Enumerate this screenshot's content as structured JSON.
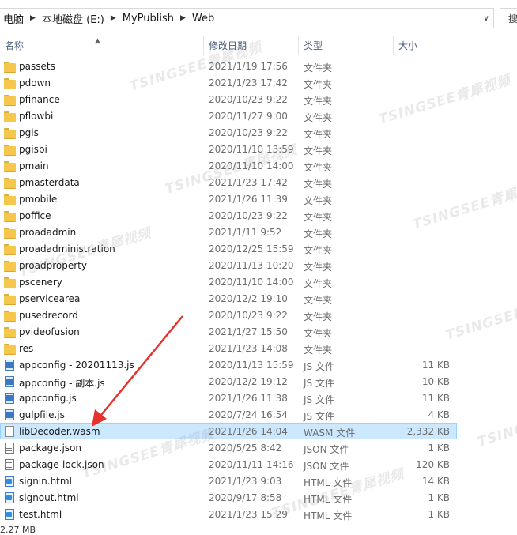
{
  "breadcrumb": {
    "items": [
      "电脑",
      "本地磁盘 (E:)",
      "MyPublish",
      "Web"
    ]
  },
  "search": {
    "text": "搜"
  },
  "columns": {
    "name": "名称",
    "date": "修改日期",
    "type": "类型",
    "size": "大小"
  },
  "files": [
    {
      "name": "passets",
      "date": "2021/1/19 17:56",
      "type": "文件夹",
      "size": "",
      "icon": "folder"
    },
    {
      "name": "pdown",
      "date": "2021/1/23 17:42",
      "type": "文件夹",
      "size": "",
      "icon": "folder"
    },
    {
      "name": "pfinance",
      "date": "2020/10/23 9:22",
      "type": "文件夹",
      "size": "",
      "icon": "folder"
    },
    {
      "name": "pflowbi",
      "date": "2020/11/27 9:00",
      "type": "文件夹",
      "size": "",
      "icon": "folder"
    },
    {
      "name": "pgis",
      "date": "2020/10/23 9:22",
      "type": "文件夹",
      "size": "",
      "icon": "folder"
    },
    {
      "name": "pgisbi",
      "date": "2020/11/10 13:59",
      "type": "文件夹",
      "size": "",
      "icon": "folder"
    },
    {
      "name": "pmain",
      "date": "2020/11/10 14:00",
      "type": "文件夹",
      "size": "",
      "icon": "folder"
    },
    {
      "name": "pmasterdata",
      "date": "2021/1/23 17:42",
      "type": "文件夹",
      "size": "",
      "icon": "folder"
    },
    {
      "name": "pmobile",
      "date": "2021/1/26 11:39",
      "type": "文件夹",
      "size": "",
      "icon": "folder"
    },
    {
      "name": "poffice",
      "date": "2020/10/23 9:22",
      "type": "文件夹",
      "size": "",
      "icon": "folder"
    },
    {
      "name": "proadadmin",
      "date": "2021/1/11 9:52",
      "type": "文件夹",
      "size": "",
      "icon": "folder"
    },
    {
      "name": "proadadministration",
      "date": "2020/12/25 15:59",
      "type": "文件夹",
      "size": "",
      "icon": "folder"
    },
    {
      "name": "proadproperty",
      "date": "2020/11/13 10:20",
      "type": "文件夹",
      "size": "",
      "icon": "folder"
    },
    {
      "name": "pscenery",
      "date": "2020/11/10 14:00",
      "type": "文件夹",
      "size": "",
      "icon": "folder"
    },
    {
      "name": "pservicearea",
      "date": "2020/12/2 19:10",
      "type": "文件夹",
      "size": "",
      "icon": "folder"
    },
    {
      "name": "pusedrecord",
      "date": "2020/10/23 9:22",
      "type": "文件夹",
      "size": "",
      "icon": "folder"
    },
    {
      "name": "pvideofusion",
      "date": "2021/1/27 15:50",
      "type": "文件夹",
      "size": "",
      "icon": "folder"
    },
    {
      "name": "res",
      "date": "2021/1/23 14:08",
      "type": "文件夹",
      "size": "",
      "icon": "folder"
    },
    {
      "name": "appconfig - 20201113.js",
      "date": "2020/11/13 15:59",
      "type": "JS 文件",
      "size": "11 KB",
      "icon": "js-file"
    },
    {
      "name": "appconfig - 副本.js",
      "date": "2020/12/2 19:12",
      "type": "JS 文件",
      "size": "10 KB",
      "icon": "js-file"
    },
    {
      "name": "appconfig.js",
      "date": "2021/1/26 11:38",
      "type": "JS 文件",
      "size": "11 KB",
      "icon": "js-file"
    },
    {
      "name": "gulpfile.js",
      "date": "2020/7/24 16:54",
      "type": "JS 文件",
      "size": "4 KB",
      "icon": "js-file"
    },
    {
      "name": "libDecoder.wasm",
      "date": "2021/1/26 14:04",
      "type": "WASM 文件",
      "size": "2,332 KB",
      "icon": "generic-file",
      "selected": true
    },
    {
      "name": "package.json",
      "date": "2020/5/25 8:42",
      "type": "JSON 文件",
      "size": "1 KB",
      "icon": "json-file"
    },
    {
      "name": "package-lock.json",
      "date": "2020/11/11 14:16",
      "type": "JSON 文件",
      "size": "120 KB",
      "icon": "json-file"
    },
    {
      "name": "signin.html",
      "date": "2021/1/23 9:03",
      "type": "HTML 文件",
      "size": "14 KB",
      "icon": "html-file"
    },
    {
      "name": "signout.html",
      "date": "2020/9/17 8:58",
      "type": "HTML 文件",
      "size": "1 KB",
      "icon": "html-file"
    },
    {
      "name": "test.html",
      "date": "2021/1/23 15:29",
      "type": "HTML 文件",
      "size": "1 KB",
      "icon": "html-file"
    }
  ],
  "watermark": {
    "text": "TSINGSEE青犀视频"
  },
  "status_bar": {
    "text": "2.27 MB"
  },
  "colors": {
    "selection": "#cce8ff",
    "selection_border": "#99d1ff",
    "header_text": "#4c607a",
    "arrow": "#e8312a"
  }
}
